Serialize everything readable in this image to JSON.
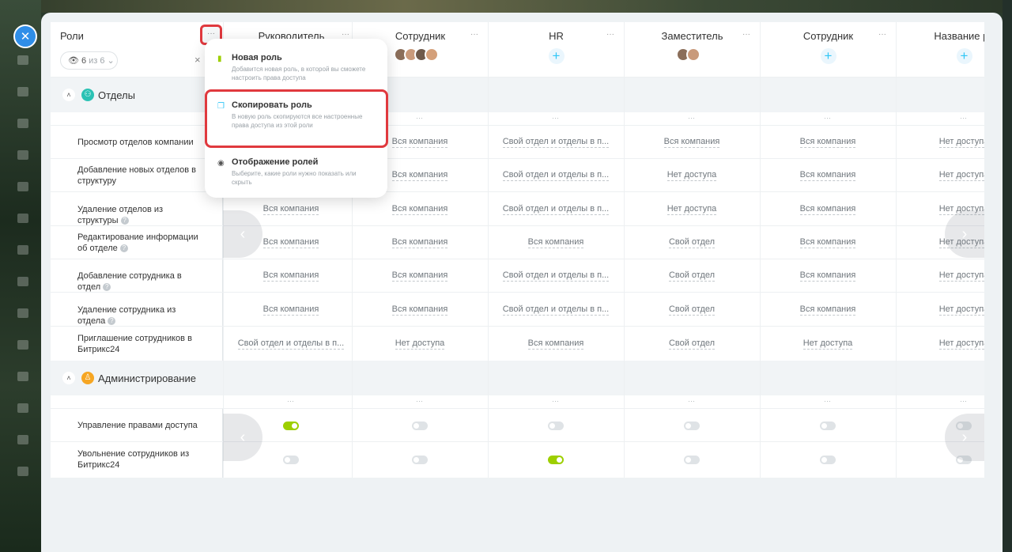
{
  "close_button": {
    "label": "✕"
  },
  "header": {
    "roles_label": "Роли",
    "dots_label": "···",
    "filter": {
      "count": "6",
      "of_text": "из 6",
      "chevron": "⌄"
    },
    "filter_clear": "×"
  },
  "columns": [
    {
      "name": "Рvководитель",
      "dots": "···",
      "kind": "avatars-none"
    },
    {
      "name": "Сотрудник",
      "dots": "···",
      "kind": "avatars"
    },
    {
      "name": "HR",
      "dots": "···",
      "kind": "plus"
    },
    {
      "name": "Заместитель",
      "dots": "···",
      "kind": "avatars2"
    },
    {
      "name": "Сотрудник",
      "dots": "···",
      "kind": "plus"
    },
    {
      "name": "Название ро",
      "dots": "",
      "kind": "plus"
    }
  ],
  "plus_label": "+",
  "sections": [
    {
      "title": "Отделы",
      "icon": "👥",
      "rows": [
        {
          "label": "Просмотр отделов компании",
          "help": false,
          "values": [
            "",
            "Вся компания",
            "Свой отдел и отделы в п...",
            "Вся компания",
            "Вся компания",
            "Нет доступа"
          ]
        },
        {
          "label": "Добавление новых отделов в структуру",
          "help": false,
          "values": [
            "",
            "Вся компания",
            "Свой отдел и отделы в п...",
            "Нет доступа",
            "Вся компания",
            "Нет доступа"
          ]
        },
        {
          "label": "Удаление отделов из структуры",
          "help": true,
          "values": [
            "Вся компания",
            "Вся компания",
            "Свой отдел и отделы в п...",
            "Нет доступа",
            "Вся компания",
            "Нет доступа"
          ]
        },
        {
          "label": "Редактирование информации об отделе",
          "help": true,
          "values": [
            "Вся компания",
            "Вся компания",
            "Вся компания",
            "Свой отдел",
            "Вся компания",
            "Нет доступа"
          ]
        },
        {
          "label": "Добавление сотрудника в отдел",
          "help": true,
          "values": [
            "Вся компания",
            "Вся компания",
            "Свой отдел и отделы в п...",
            "Свой отдел",
            "Вся компания",
            "Нет доступа"
          ]
        },
        {
          "label": "Удаление сотрудника из отдела",
          "help": true,
          "values": [
            "Вся компания",
            "Вся компания",
            "Свой отдел и отделы в п...",
            "Свой отдел",
            "Вся компания",
            "Нет доступа"
          ]
        },
        {
          "label": "Приглашение сотрудников в Битрикс24",
          "help": false,
          "values": [
            "Свой отдел и отделы в п...",
            "Нет доступа",
            "Вся компания",
            "Свой отдел",
            "Нет доступа",
            "Нет доступа"
          ]
        }
      ]
    },
    {
      "title": "Администрирование",
      "icon": "👤",
      "rows": [
        {
          "label": "Управление правами доступа",
          "toggles": [
            true,
            false,
            false,
            false,
            false,
            false
          ]
        },
        {
          "label": "Увольнение сотрудников из Битрикс24",
          "toggles": [
            false,
            false,
            true,
            false,
            false,
            false
          ]
        }
      ]
    }
  ],
  "help_icon": "?",
  "dots_cell": "···",
  "nav": {
    "left": "‹",
    "right": "›"
  },
  "menu": {
    "items": [
      {
        "title": "Новая роль",
        "desc": "Добавится новая роль, в которой вы сможете настроить права доступа"
      },
      {
        "title": "Скопировать роль",
        "desc": "В новую роль скопируются все настроенные права доступа из этой роли"
      },
      {
        "title": "Отображение ролей",
        "desc": "Выберите, какие роли нужно показать или скрыть"
      }
    ]
  },
  "colors": {
    "accent": "#2fc6f6",
    "toggle_on": "#9dcf00",
    "highlight": "#e0393e",
    "section_teal": "#2bc2b4",
    "section_orange": "#f6a623",
    "close_blue": "#2f8ee8"
  }
}
